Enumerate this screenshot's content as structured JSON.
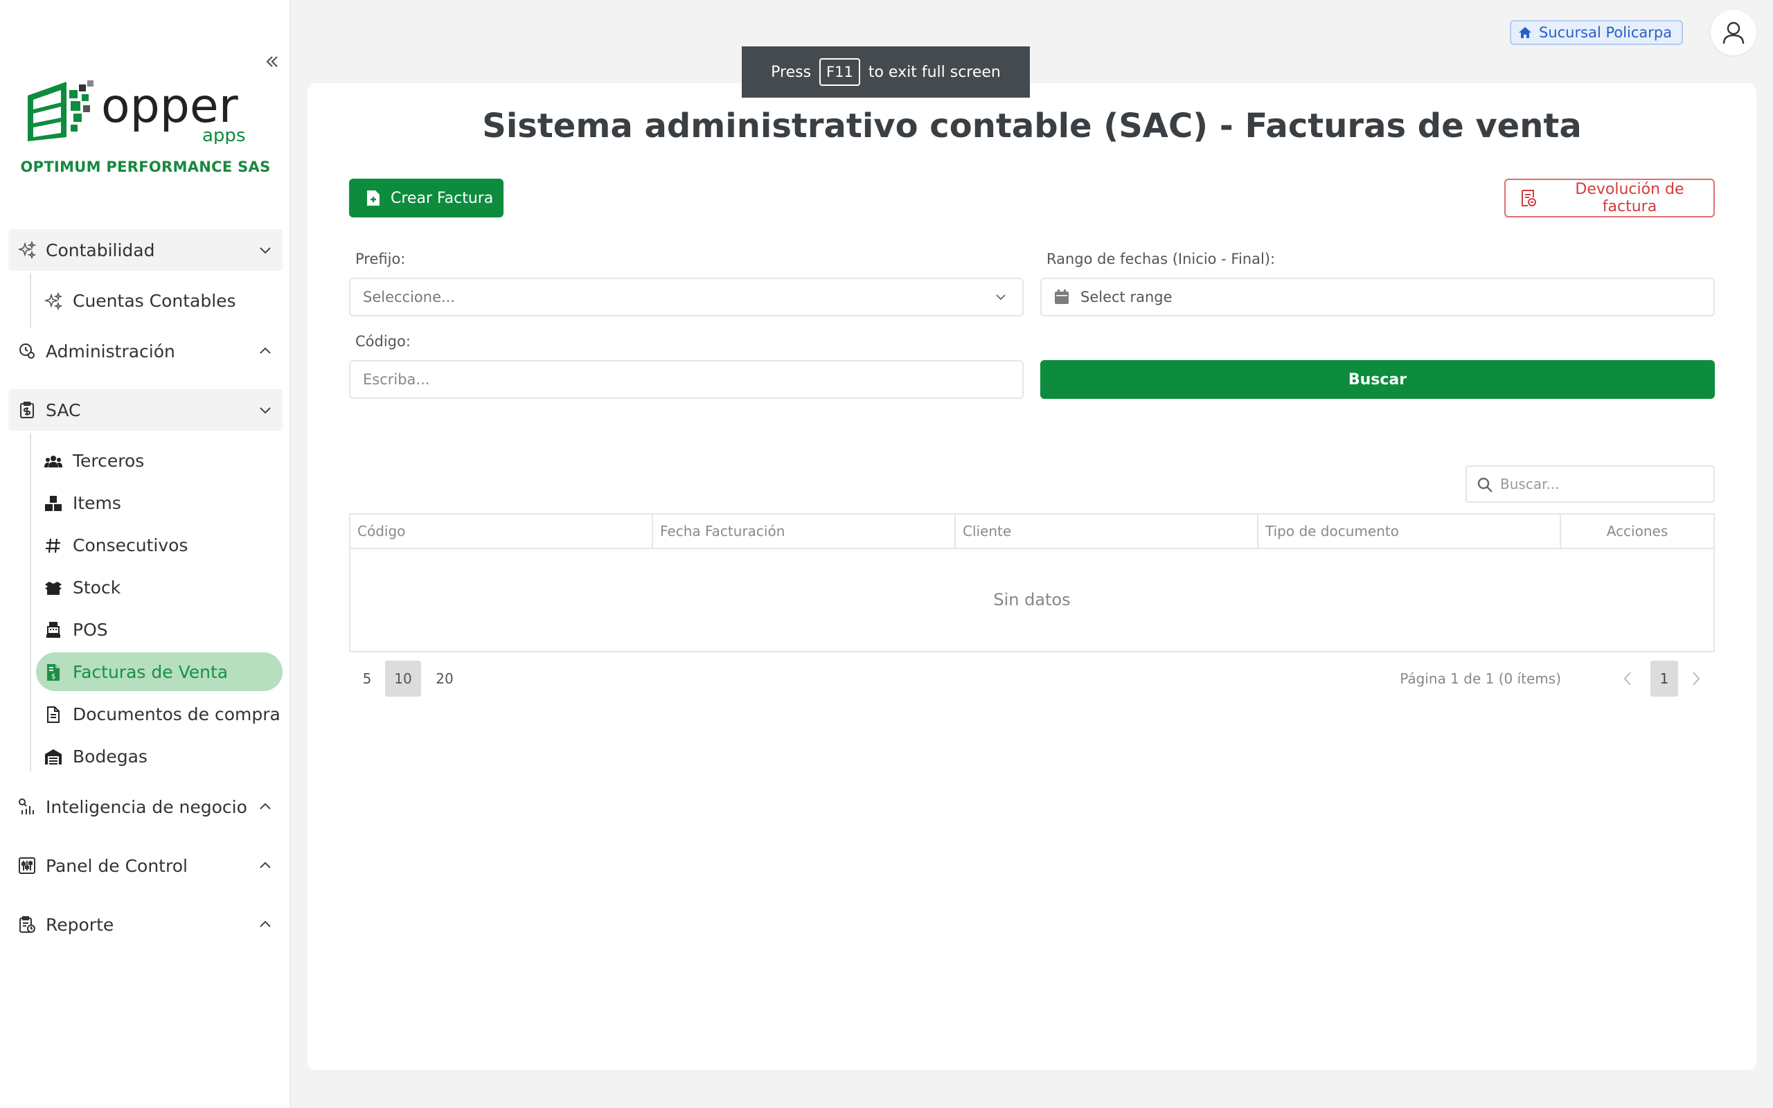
{
  "sidebar": {
    "logo": {
      "main": "opper",
      "sub": "apps"
    },
    "company": "OPTIMUM PERFORMANCE SAS",
    "groups": {
      "contabilidad": {
        "label": "Contabilidad",
        "icon": "sparkles-icon",
        "items": [
          {
            "label": "Cuentas Contables",
            "icon": "sparkles-icon"
          }
        ]
      },
      "administracion": {
        "label": "Administración",
        "icon": "shield-gear-icon"
      },
      "sac": {
        "label": "SAC",
        "icon": "clipboard-dollar-icon",
        "items": [
          {
            "label": "Terceros",
            "icon": "people-icon"
          },
          {
            "label": "Items",
            "icon": "boxes-icon"
          },
          {
            "label": "Consecutivos",
            "icon": "hash-icon"
          },
          {
            "label": "Stock",
            "icon": "open-box-icon"
          },
          {
            "label": "POS",
            "icon": "cash-register-icon"
          },
          {
            "label": "Facturas de Venta",
            "icon": "invoice-dollar-icon",
            "active": true
          },
          {
            "label": "Documentos de compra",
            "icon": "document-icon"
          },
          {
            "label": "Bodegas",
            "icon": "warehouse-icon"
          }
        ]
      },
      "inteligencia": {
        "label": "Inteligencia de negocio",
        "icon": "bi-chart-icon"
      },
      "panel": {
        "label": "Panel de Control",
        "icon": "sliders-icon"
      },
      "reporte": {
        "label": "Reporte",
        "icon": "report-clipboard-icon"
      }
    }
  },
  "header": {
    "branch": "Sucursal Policarpa",
    "toast": {
      "pre": "Press",
      "key": "F11",
      "post": "to exit full screen"
    }
  },
  "main": {
    "title": "Sistema administrativo contable (SAC) - Facturas de venta",
    "create_label": "Crear Factura",
    "return_label": "Devolución de factura",
    "filters": {
      "prefix_label": "Prefijo:",
      "prefix_placeholder": "Seleccione...",
      "range_label": "Rango de fechas (Inicio - Final):",
      "range_placeholder": "Select range",
      "code_label": "Código:",
      "code_placeholder": "Escriba...",
      "search_label": "Buscar"
    },
    "table": {
      "search_placeholder": "Buscar...",
      "columns": [
        "Código",
        "Fecha Facturación",
        "Cliente",
        "Tipo de documento",
        "Acciones"
      ],
      "empty": "Sin datos",
      "page_sizes": [
        "5",
        "10",
        "20"
      ],
      "selected_page_size": "10",
      "page_info": "Página 1 de 1 (0 ítems)",
      "current_page": "1"
    }
  },
  "colors": {
    "primary": "#0e8c3e",
    "danger": "#d33c3c",
    "active_bg": "#b5dfbf",
    "badge_blue": "#2860c8"
  }
}
